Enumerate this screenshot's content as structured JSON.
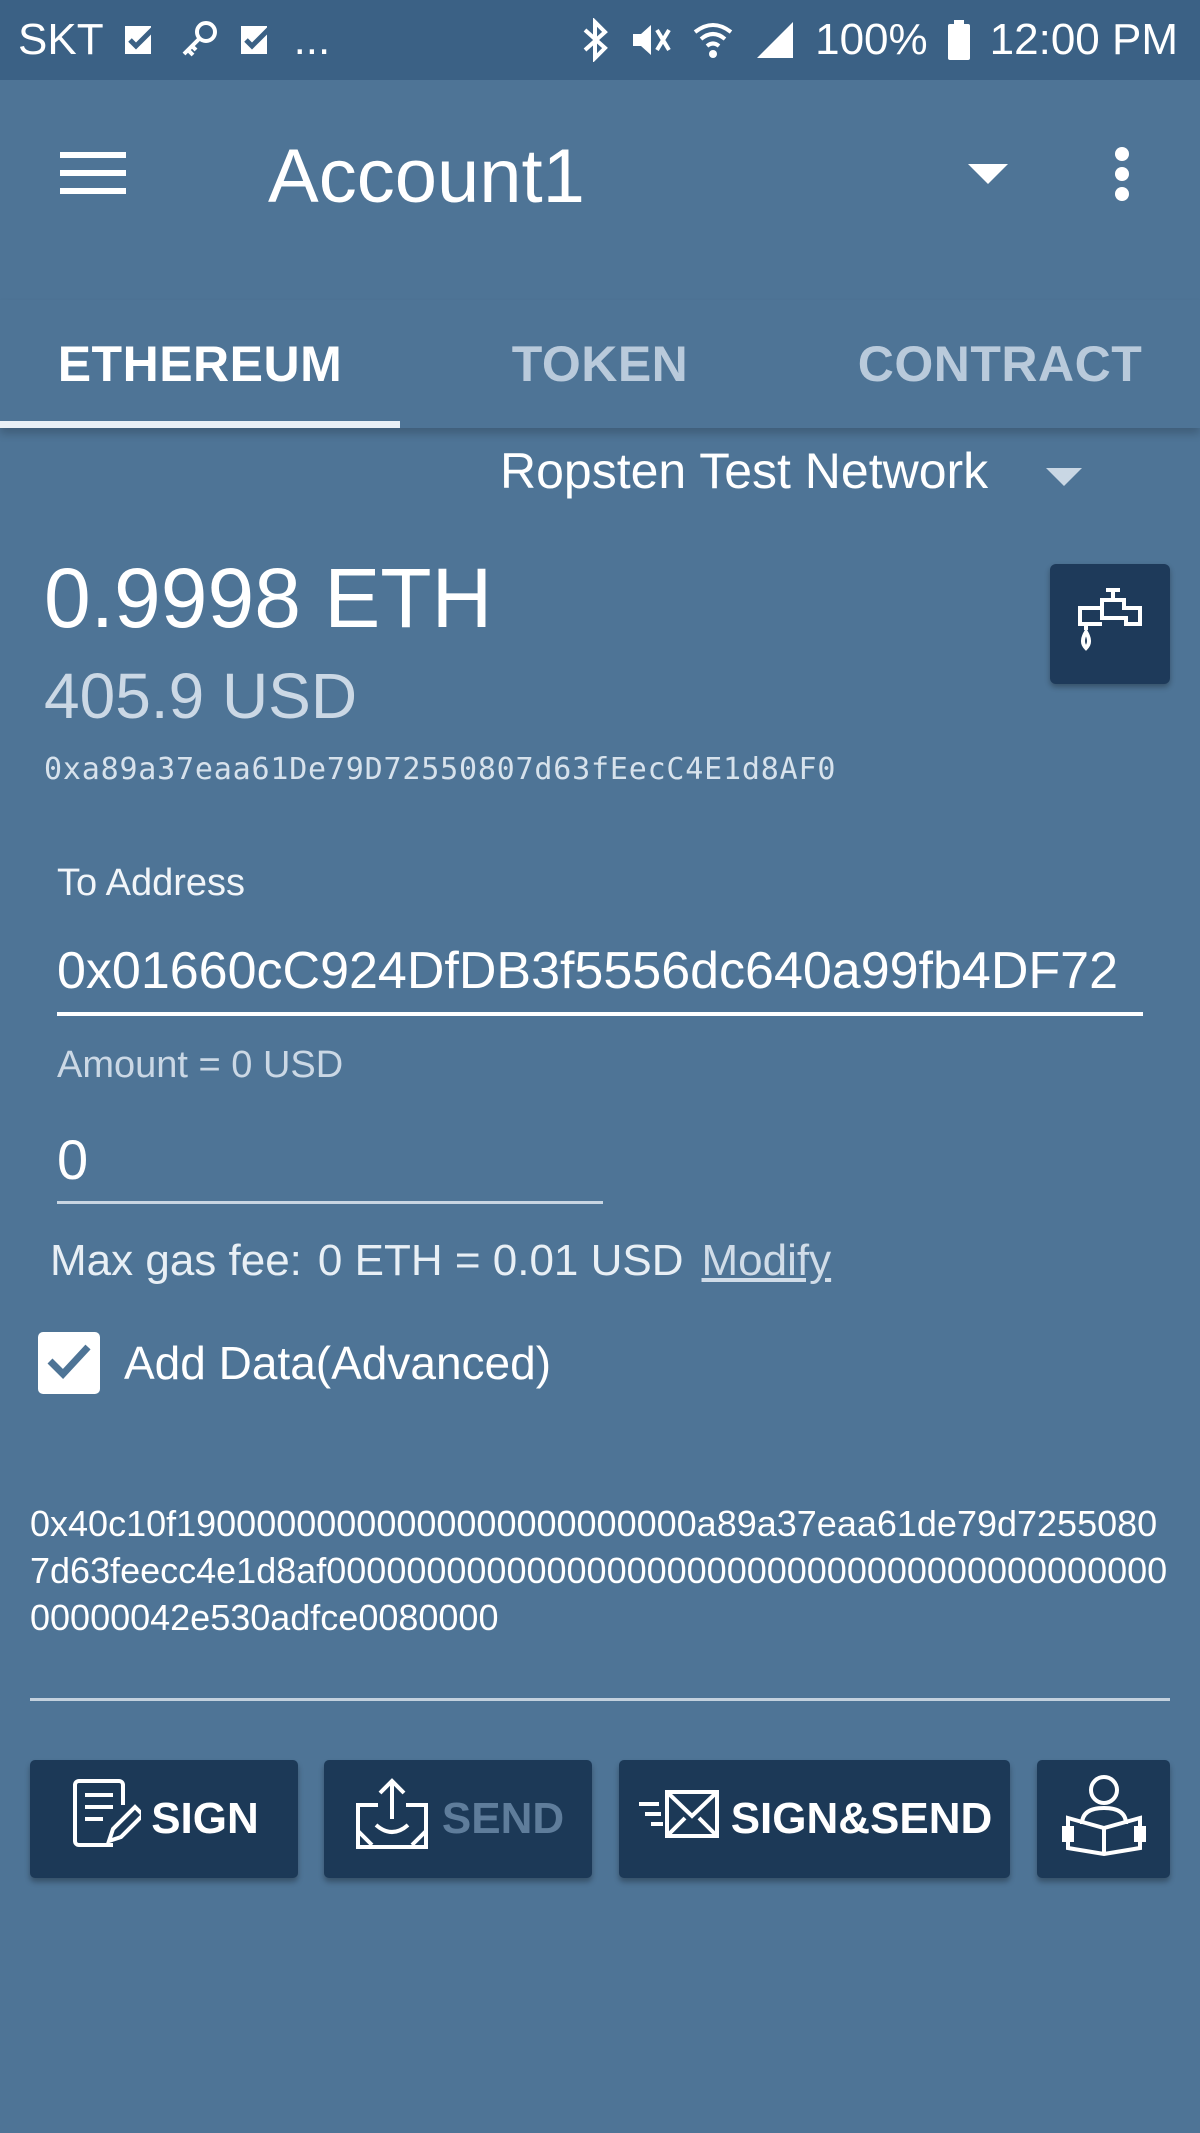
{
  "status_bar": {
    "carrier": "SKT",
    "battery": "100%",
    "time": "12:00 PM",
    "ellipsis": "..."
  },
  "header": {
    "title": "Account1"
  },
  "tabs": [
    {
      "label": "ETHEREUM",
      "active": true
    },
    {
      "label": "TOKEN",
      "active": false
    },
    {
      "label": "CONTRACT",
      "active": false
    }
  ],
  "network": {
    "selected": "Ropsten Test Network"
  },
  "balance": {
    "eth": "0.9998 ETH",
    "usd": "405.9 USD",
    "address": "0xa89a37eaa61De79D72550807d63fEecC4E1d8AF0"
  },
  "form": {
    "to_label": "To Address",
    "to_value": "0x01660cC924DfDB3f5556dc640a99fb4DF72",
    "amount_label": "Amount = 0 USD",
    "amount_value": "0",
    "gas_label": "Max gas fee:",
    "gas_value": "0 ETH = 0.01 USD",
    "modify_link": "Modify",
    "add_data_label": "Add Data(Advanced)",
    "add_data_checked": true,
    "data_value": "0x40c10f19000000000000000000000000a89a37eaa61de79d72550807d63feecc4e1d8af00000000000000000000000000000000000000000000000042e530adfce0080000"
  },
  "actions": {
    "sign_label": "SIGN",
    "send_label": "SEND",
    "sign_send_label": "SIGN&SEND"
  },
  "colors": {
    "background": "#4e7496",
    "status_bar": "#3b6185",
    "button": "#1c3957",
    "disabled_text": "#5f7d9b"
  }
}
